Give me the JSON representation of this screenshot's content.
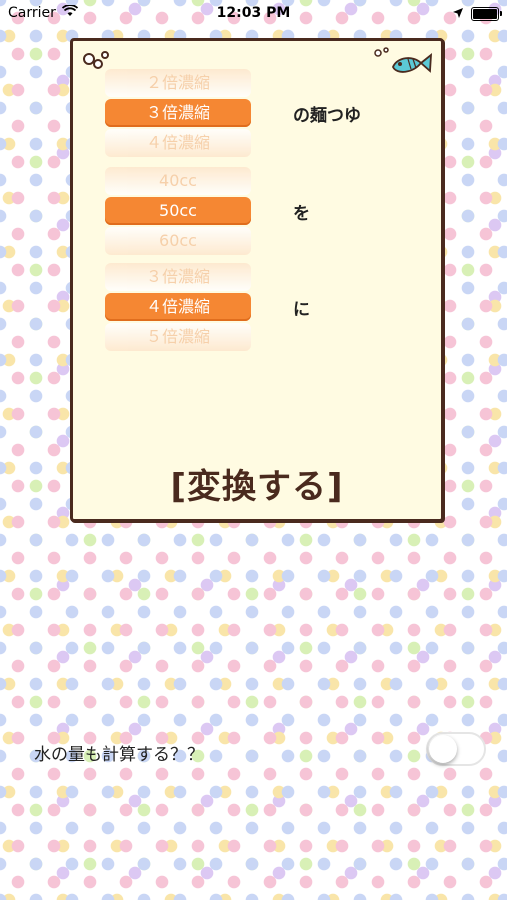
{
  "status": {
    "carrier": "Carrier",
    "time": "12:03 PM"
  },
  "picker1": {
    "above": "２倍濃縮",
    "selected": "３倍濃縮",
    "below": "４倍濃縮",
    "suffix": "の麺つゆ"
  },
  "picker2": {
    "above": "40cc",
    "selected": "50cc",
    "below": "60cc",
    "suffix": "を"
  },
  "picker3": {
    "above": "３倍濃縮",
    "selected": "４倍濃縮",
    "below": "５倍濃縮",
    "suffix": "に"
  },
  "convert_label": "[変換する]",
  "water": {
    "label": "水の量も計算する？？",
    "toggle_on": false
  },
  "colors": {
    "accent": "#f58733",
    "frame": "#4a2a1e",
    "card_bg": "#fffbe2"
  }
}
